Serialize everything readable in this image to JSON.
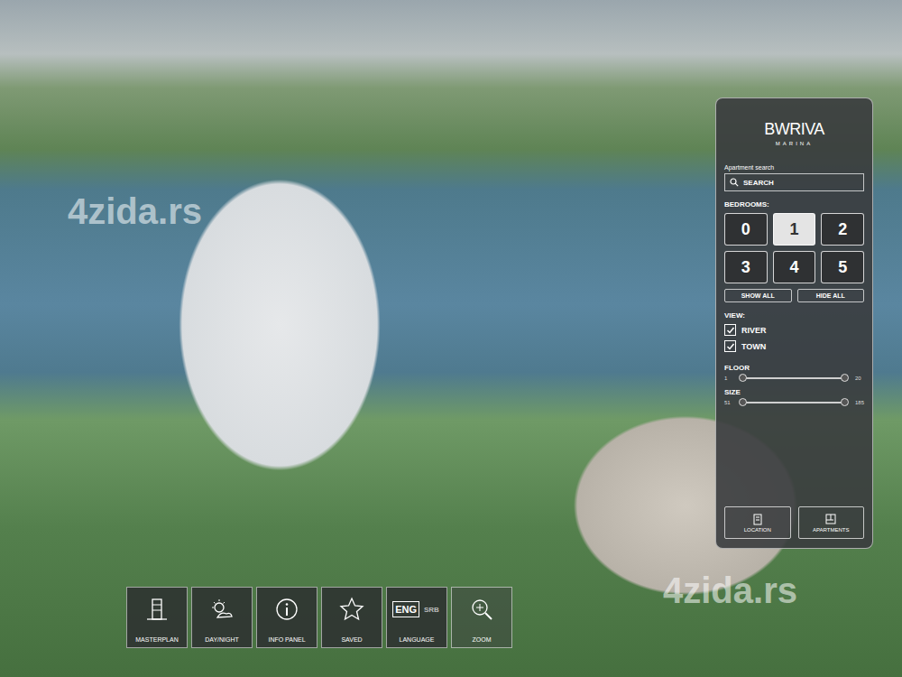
{
  "scene": {
    "watermarks": [
      "4zida.rs",
      "4zida.rs"
    ]
  },
  "panel": {
    "logo": "BWRIVA",
    "logo_sub": "MARINA",
    "search_label": "Apartment search",
    "search_button": "SEARCH",
    "bedrooms_label": "BEDROOMS:",
    "bedrooms": [
      {
        "label": "0",
        "selected": false
      },
      {
        "label": "1",
        "selected": true
      },
      {
        "label": "2",
        "selected": false
      },
      {
        "label": "3",
        "selected": false
      },
      {
        "label": "4",
        "selected": false
      },
      {
        "label": "5",
        "selected": false
      }
    ],
    "show_all": "SHOW ALL",
    "hide_all": "HIDE ALL",
    "view_label": "VIEW:",
    "views": [
      {
        "label": "RIVER",
        "checked": true
      },
      {
        "label": "TOWN",
        "checked": true
      }
    ],
    "sliders": [
      {
        "label": "FLOOR",
        "min": "1",
        "max": "20",
        "low": 0,
        "high": 1
      },
      {
        "label": "SIZE",
        "min": "51",
        "max": "185",
        "low": 0,
        "high": 1
      }
    ],
    "footer_buttons": [
      {
        "label": "LOCATION"
      },
      {
        "label": "APARTMENTS"
      }
    ]
  },
  "toolbar": [
    {
      "label": "MASTERPLAN"
    },
    {
      "label": "DAY/NIGHT"
    },
    {
      "label": "INFO PANEL"
    },
    {
      "label": "SAVED"
    },
    {
      "label": "LANGUAGE",
      "languages": [
        {
          "label": "ENG",
          "selected": true
        },
        {
          "label": "SRB",
          "selected": false
        }
      ]
    },
    {
      "label": "ZOOM"
    }
  ]
}
